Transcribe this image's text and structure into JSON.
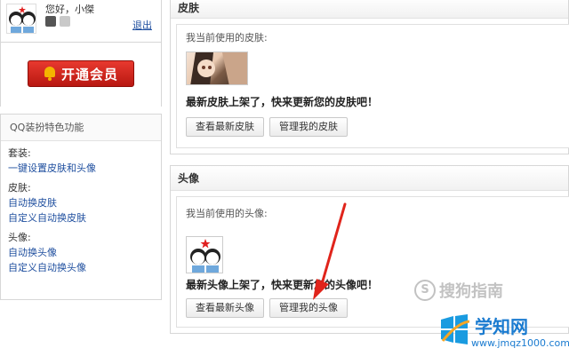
{
  "user": {
    "greeting": "您好，小傑",
    "logout": "退出"
  },
  "vip": {
    "label": "开通会员",
    "icon": "bell-icon"
  },
  "features": {
    "title": "QQ装扮特色功能",
    "groups": [
      {
        "label": "套装:",
        "links": [
          "一键设置皮肤和头像"
        ]
      },
      {
        "label": "皮肤:",
        "links": [
          "自动换皮肤",
          "自定义自动换皮肤"
        ]
      },
      {
        "label": "头像:",
        "links": [
          "自动换头像",
          "自定义自动换头像"
        ]
      }
    ]
  },
  "skin_panel": {
    "title": "皮肤",
    "current_label": "我当前使用的皮肤:",
    "promo": "最新皮肤上架了，快来更新您的皮肤吧！",
    "btn_view": "查看最新皮肤",
    "btn_manage": "管理我的皮肤"
  },
  "avatar_panel": {
    "title": "头像",
    "current_label": "我当前使用的头像:",
    "promo": "最新头像上架了，快来更新您的头像吧！",
    "btn_view": "查看最新头像",
    "btn_manage": "管理我的头像"
  },
  "watermarks": {
    "sogou_text": "搜狗指南",
    "sogou_icon": "S",
    "site_title": "学知网",
    "site_url": "www.jmqz1000.com"
  },
  "colors": {
    "vip_red": "#d32a20",
    "link_blue": "#1f4f9f",
    "arrow_red": "#e0241b",
    "watermark_blue": "#1a7bd0"
  }
}
